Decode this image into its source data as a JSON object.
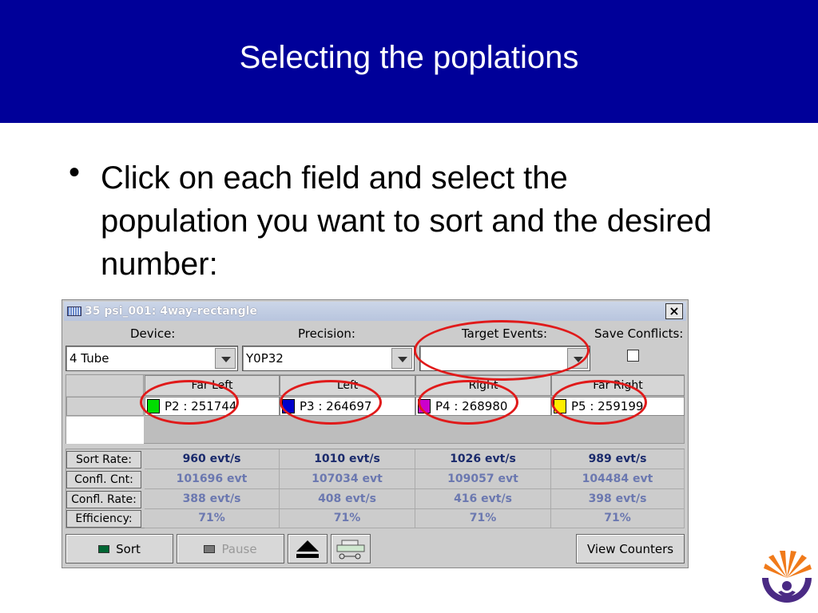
{
  "slide": {
    "title": "Selecting the poplations",
    "bullet_symbol": "•",
    "bullet_text": "Click on each field and select the population you want to sort and the desired number:"
  },
  "window": {
    "title": "35 psi_001: 4way-rectangle",
    "close_glyph": "×",
    "labels": {
      "device": "Device:",
      "precision": "Precision:",
      "target_events": "Target Events:",
      "save_conflicts": "Save Conflicts:"
    },
    "device_value": "4 Tube",
    "precision_value": "Y0P32",
    "target_events_value": "",
    "save_conflicts_checked": false,
    "columns": [
      "Far Left",
      "Left",
      "Right",
      "Far Right"
    ],
    "populations": [
      {
        "label": "P2 : 251744",
        "color": "#00dd00"
      },
      {
        "label": "P3 : 264697",
        "color": "#0000cc"
      },
      {
        "label": "P4 : 268980",
        "color": "#cc00cc"
      },
      {
        "label": "P5 : 259199",
        "color": "#ffee00"
      }
    ],
    "stats": {
      "row_labels": [
        "Sort Rate:",
        "Confl. Cnt:",
        "Confl. Rate:",
        "Efficiency:"
      ],
      "sort_rate": [
        "960 evt/s",
        "1010 evt/s",
        "1026 evt/s",
        "989 evt/s"
      ],
      "confl_cnt": [
        "101696 evt",
        "107034 evt",
        "109057 evt",
        "104484 evt"
      ],
      "confl_rate": [
        "388 evt/s",
        "408 evt/s",
        "416 evt/s",
        "398 evt/s"
      ],
      "efficiency": [
        "71%",
        "71%",
        "71%",
        "71%"
      ]
    },
    "buttons": {
      "sort": "Sort",
      "pause": "Pause",
      "view_counters": "View Counters"
    }
  },
  "colors": {
    "title_bar": "#000099",
    "highlight": "#e01a1a"
  }
}
